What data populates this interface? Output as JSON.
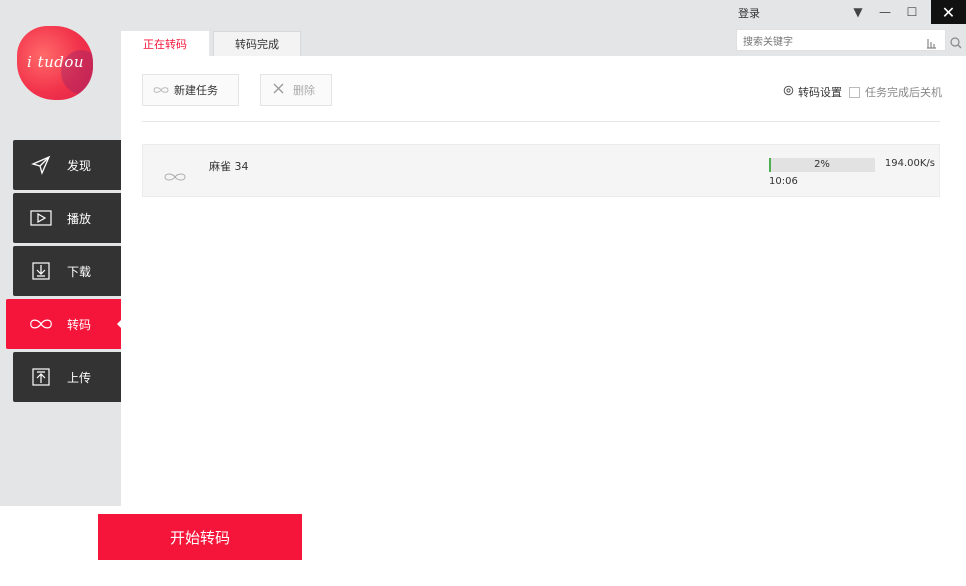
{
  "app": {
    "logo_text": "i tudou",
    "accent_color": "#f5153a"
  },
  "window": {
    "login_label": "登录",
    "minimize_glyph": "—",
    "maximize_glyph": "☐",
    "close_glyph": "✕",
    "dropdown_glyph": "▼"
  },
  "tabs": [
    {
      "label": "正在转码",
      "active": true
    },
    {
      "label": "转码完成",
      "active": false
    }
  ],
  "search": {
    "placeholder": "搜索关键字"
  },
  "sidebar": {
    "items": [
      {
        "label": "发现",
        "icon": "paper-plane-icon"
      },
      {
        "label": "播放",
        "icon": "play-icon"
      },
      {
        "label": "下载",
        "icon": "download-icon"
      },
      {
        "label": "转码",
        "icon": "infinity-icon",
        "active": true
      },
      {
        "label": "上传",
        "icon": "upload-icon"
      }
    ]
  },
  "toolbar": {
    "new_task_label": "新建任务",
    "delete_label": "删除",
    "settings_label": "转码设置",
    "shutdown_label": "任务完成后关机"
  },
  "tasks": [
    {
      "name": "麻雀 34",
      "progress_text": "2%",
      "progress_value": 0.02,
      "time": "10:06",
      "speed": "194.00K/s"
    }
  ],
  "footer": {
    "start_label": "开始转码"
  }
}
